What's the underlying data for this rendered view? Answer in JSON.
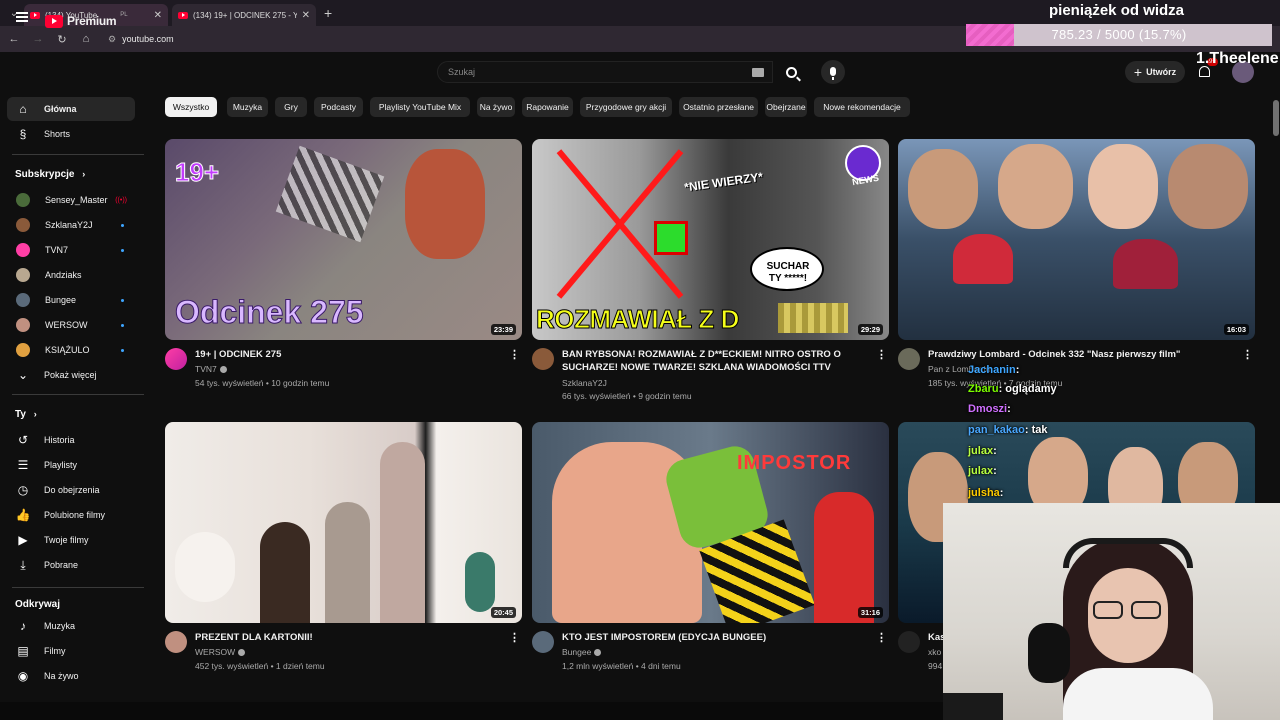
{
  "browser": {
    "tabs": [
      {
        "title": "(134) YouTube"
      },
      {
        "title": "(134) 19+ | ODCINEK 275 - YouTube"
      }
    ],
    "url": "youtube.com"
  },
  "masthead": {
    "logo_text": "Premium",
    "logo_region": "PL",
    "search_placeholder": "Szukaj",
    "create_label": "Utwórz",
    "notif_count": "9+"
  },
  "overlay": {
    "donation_title": "pieniążek od widza",
    "donation_text": "785.23 / 5000 (15.7%)",
    "donation_progress": 0.157,
    "streamer_name": "1.Theelene"
  },
  "sidebar": {
    "main": [
      {
        "label": "Główna",
        "icon": "home-icon"
      },
      {
        "label": "Shorts",
        "icon": "shorts-icon"
      }
    ],
    "subs_heading": "Subskrypcje",
    "subs": [
      {
        "label": "Sensey_Master",
        "color": "#4a6b3a",
        "badge": "live"
      },
      {
        "label": "SzklanaY2J",
        "color": "#8a5a3a",
        "badge": "dot"
      },
      {
        "label": "TVN7",
        "color": "#ff3ea5",
        "badge": "dot"
      },
      {
        "label": "Andziaks",
        "color": "#b8a890",
        "badge": ""
      },
      {
        "label": "Bungee",
        "color": "#5a6a7a",
        "badge": "dot"
      },
      {
        "label": "WERSOW",
        "color": "#c09080",
        "badge": "dot"
      },
      {
        "label": "KSIĄŻULO",
        "color": "#e0a040",
        "badge": "dot"
      }
    ],
    "show_more": "Pokaż więcej",
    "you_heading": "Ty",
    "you": [
      {
        "label": "Historia",
        "icon": "history-icon"
      },
      {
        "label": "Playlisty",
        "icon": "playlists-icon"
      },
      {
        "label": "Do obejrzenia",
        "icon": "watch-later-icon"
      },
      {
        "label": "Polubione filmy",
        "icon": "like-icon"
      },
      {
        "label": "Twoje filmy",
        "icon": "your-videos-icon"
      },
      {
        "label": "Pobrane",
        "icon": "download-icon"
      }
    ],
    "explore_heading": "Odkrywaj",
    "explore": [
      {
        "label": "Muzyka",
        "icon": "music-icon"
      },
      {
        "label": "Filmy",
        "icon": "movies-icon"
      },
      {
        "label": "Na żywo",
        "icon": "live-icon"
      }
    ]
  },
  "chips": [
    "Wszystko",
    "Muzyka",
    "Gry",
    "Podcasty",
    "Playlisty YouTube Mix",
    "Na żywo",
    "Rapowanie",
    "Przygodowe gry akcji",
    "Ostatnio przesłane",
    "Obejrzane",
    "Nowe rekomendacje"
  ],
  "videos": [
    {
      "title": "19+ | ODCINEK 275",
      "channel": "TVN7",
      "verified": true,
      "meta": "54 tys. wyświetleń • 10 godzin temu",
      "duration": "23:39",
      "overlay": "Odcinek 275",
      "badge": "19+"
    },
    {
      "title": "BAN RYBSONA! ROZMAWIAŁ Z D**ECKIEM! NITRO OSTRO O SUCHARZE! NOWE TWARZE! SZKLANA WIADOMOŚCI TTV",
      "channel": "SzklanaY2J",
      "verified": false,
      "meta": "66 tys. wyświetleń • 9 godzin temu",
      "duration": "29:29",
      "overlay": "ROZMAWIAŁ Z D",
      "bubble1": "SUCHAR",
      "bubble2": "TY *****!",
      "tag": "*NIE WIERZY*",
      "news": "NEWS"
    },
    {
      "title": "Prawdziwy Lombard - Odcinek 332 \"Nasz pierwszy film\"",
      "channel": "Pan z Lombardu",
      "verified": false,
      "meta": "185 tys. wyświetleń • 7 godzin temu",
      "duration": "16:03"
    },
    {
      "title": "PREZENT DLA KARTONII!",
      "channel": "WERSOW",
      "verified": true,
      "meta": "452 tys. wyświetleń • 1 dzień temu",
      "duration": "20:45"
    },
    {
      "title": "KTO JEST IMPOSTOREM (EDYCJA BUNGEE)",
      "channel": "Bungee",
      "verified": true,
      "meta": "1,2 mln wyświetleń • 4 dni temu",
      "duration": "31:16",
      "overlay": "IMPOSTOR"
    },
    {
      "title": "Kas",
      "channel": "xko",
      "verified": false,
      "meta": "994",
      "duration": ""
    }
  ],
  "chat": [
    {
      "user": "Jachanin",
      "text": ":",
      "color": "#3ea6ff"
    },
    {
      "user": "Zbaru",
      "text": ": oglądamy",
      "color": "#7CFC00"
    },
    {
      "user": "Dmoszi",
      "text": ":",
      "color": "#d070ff"
    },
    {
      "user": "pan_kakao",
      "text": ": tak",
      "color": "#4aa8ff"
    },
    {
      "user": "julax",
      "text": ":",
      "color": "#b9ff40"
    },
    {
      "user": "julax",
      "text": ":",
      "color": "#b9ff40"
    },
    {
      "user": "julsha",
      "text": ":",
      "color": "#ffcc00"
    }
  ]
}
